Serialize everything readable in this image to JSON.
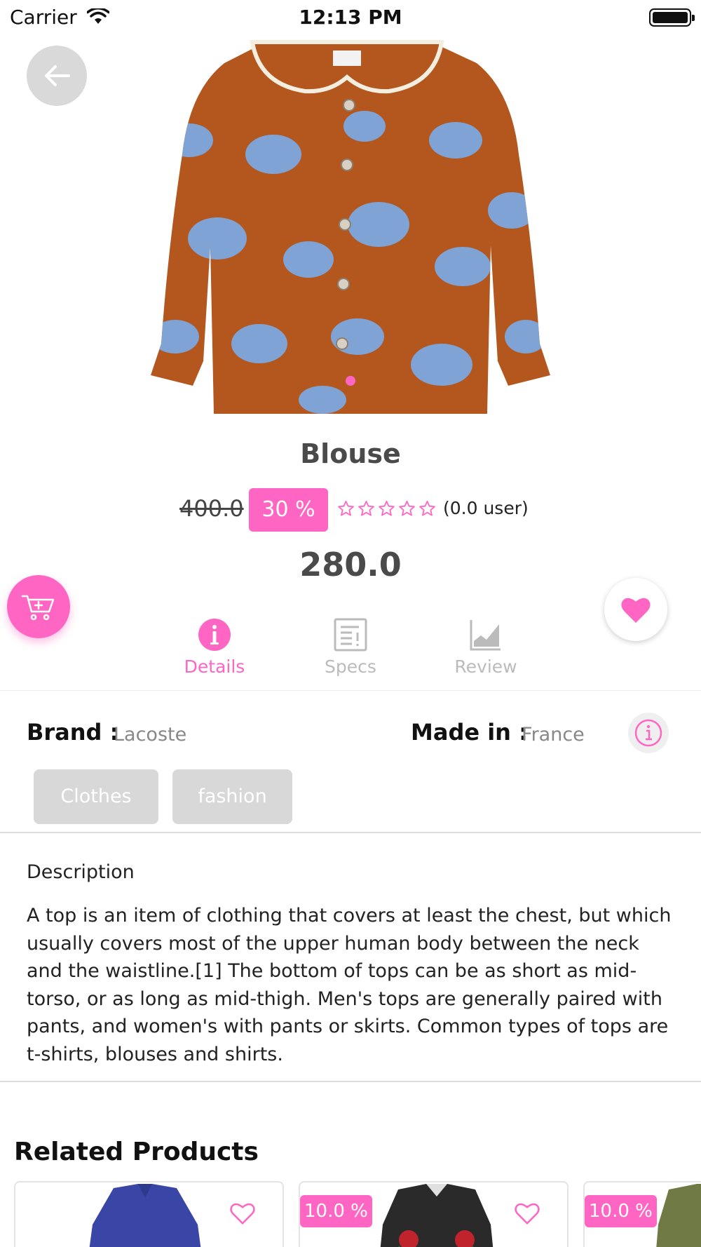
{
  "status_bar": {
    "carrier": "Carrier",
    "time": "12:13 PM"
  },
  "product": {
    "name": "Blouse",
    "old_price": "400.0",
    "discount": "30 %",
    "rating_count": "(0.0 user)",
    "rating_value": 0,
    "rating_max": 5,
    "price": "280.0",
    "image_pages": 1
  },
  "tabs": [
    {
      "label": "Details",
      "icon": "info-icon",
      "active": true
    },
    {
      "label": "Specs",
      "icon": "specs-document-icon",
      "active": false
    },
    {
      "label": "Review",
      "icon": "area-chart-icon",
      "active": false
    }
  ],
  "details": {
    "brand_label": "Brand :",
    "brand_value": "Lacoste",
    "made_in_label": "Made in :",
    "made_in_value": "France",
    "tags": [
      "Clothes",
      "fashion"
    ]
  },
  "description": {
    "title": "Description",
    "body": "A top is an item of clothing that covers at least the chest, but which usually covers most of the upper human body between the neck and the waistline.[1] The bottom of tops can be as short as mid-torso, or as long as mid-thigh. Men's tops are generally paired with pants, and women's with pants or skirts. Common types of tops are t-shirts, blouses and shirts."
  },
  "related": {
    "title": "Related Products",
    "items": [
      {
        "badge": ""
      },
      {
        "badge": "10.0 %"
      },
      {
        "badge": "10.0 %"
      }
    ]
  },
  "colors": {
    "accent": "#ff66c4",
    "shirt": "#b4571f",
    "pattern": "#7ea3d4",
    "tag_bg": "#d8d8d8",
    "inactive": "#bbbbbb"
  }
}
